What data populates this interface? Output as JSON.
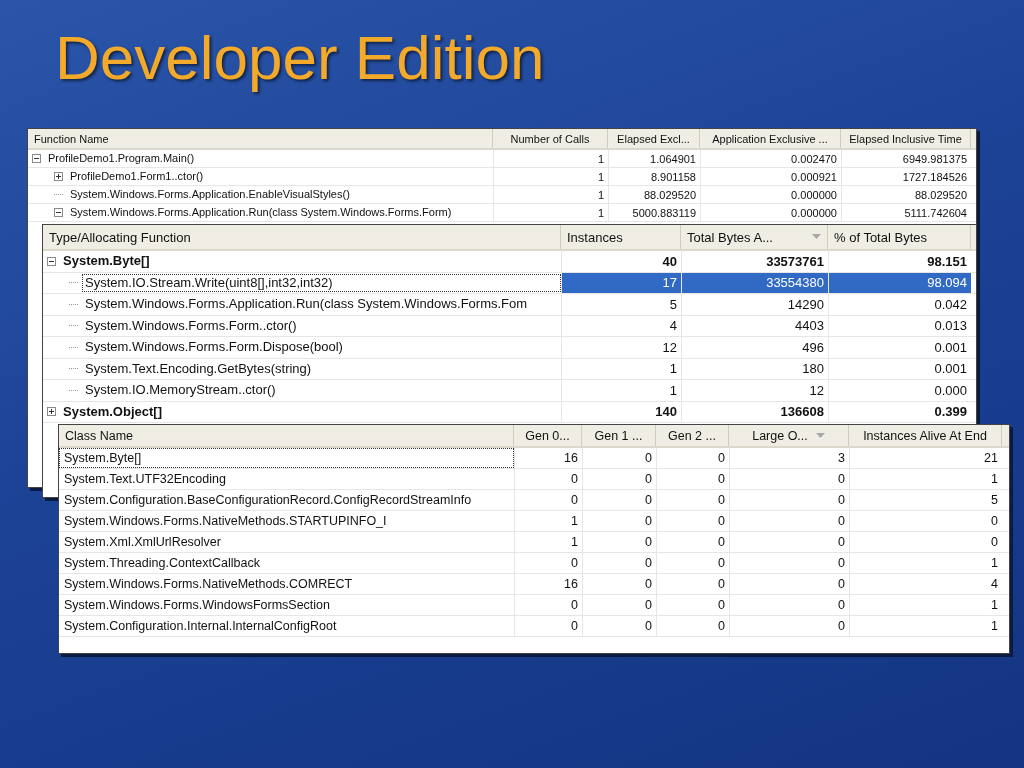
{
  "slide": {
    "title": "Developer Edition"
  },
  "panels": [
    {
      "name_column": {
        "label": "Function Name",
        "sorted": false
      },
      "columns": [
        {
          "label": "Number of Calls",
          "sorted": false
        },
        {
          "label": "Elapsed Excl...",
          "sorted": false
        },
        {
          "label": "Application Exclusive ...",
          "sorted": false
        },
        {
          "label": "Elapsed Inclusive Time",
          "sorted": false
        }
      ],
      "rows": [
        {
          "name": "ProfileDemo1.Program.Main()",
          "cells": [
            "1",
            "1.064901",
            "0.002470",
            "6949.981375"
          ],
          "expanded": true,
          "children": [
            {
              "name": "ProfileDemo1.Form1..ctor()",
              "cells": [
                "1",
                "8.901158",
                "0.000921",
                "1727.184526"
              ],
              "expanded": false
            },
            {
              "name": "System.Windows.Forms.Application.EnableVisualStyles()",
              "cells": [
                "1",
                "88.029520",
                "0.000000",
                "88.029520"
              ]
            },
            {
              "name": "System.Windows.Forms.Application.Run(class System.Windows.Forms.Form)",
              "cells": [
                "1",
                "5000.883119",
                "0.000000",
                "5111.742604"
              ],
              "expanded": true
            }
          ]
        }
      ]
    },
    {
      "name_column": {
        "label": "Type/Allocating Function",
        "sorted": false
      },
      "columns": [
        {
          "label": "Instances",
          "sorted": false
        },
        {
          "label": "Total Bytes A...",
          "sorted": true
        },
        {
          "label": "% of Total Bytes",
          "sorted": false
        }
      ],
      "rows": [
        {
          "name": "System.Byte[]",
          "bold": true,
          "cells": [
            "40",
            "33573761",
            "98.151"
          ],
          "expanded": true,
          "selected": false,
          "children": [
            {
              "name": "System.IO.Stream.Write(uint8[],int32,int32)",
              "cells": [
                "17",
                "33554380",
                "98.094"
              ],
              "selected": true
            },
            {
              "name": "System.Windows.Forms.Application.Run(class System.Windows.Forms.Fom",
              "cells": [
                "5",
                "14290",
                "0.042"
              ],
              "selected": false
            },
            {
              "name": "System.Windows.Forms.Form..ctor()",
              "cells": [
                "4",
                "4403",
                "0.013"
              ],
              "selected": false
            },
            {
              "name": "System.Windows.Forms.Form.Dispose(bool)",
              "cells": [
                "12",
                "496",
                "0.001"
              ],
              "selected": false
            },
            {
              "name": "System.Text.Encoding.GetBytes(string)",
              "cells": [
                "1",
                "180",
                "0.001"
              ],
              "selected": false
            },
            {
              "name": "System.IO.MemoryStream..ctor()",
              "cells": [
                "1",
                "12",
                "0.000"
              ],
              "selected": false
            }
          ]
        },
        {
          "name": "System.Object[]",
          "bold": true,
          "cells": [
            "140",
            "136608",
            "0.399"
          ],
          "expanded": false,
          "selected": false
        }
      ]
    },
    {
      "name_column": {
        "label": "Class Name",
        "sorted": false
      },
      "columns": [
        {
          "label": "Gen 0...",
          "sorted": false
        },
        {
          "label": "Gen 1 ...",
          "sorted": false
        },
        {
          "label": "Gen 2 ...",
          "sorted": false
        },
        {
          "label": "Large O...",
          "sorted": true
        },
        {
          "label": "Instances Alive At End",
          "sorted": false
        }
      ],
      "rows": [
        {
          "name": "System.Byte[]",
          "cells": [
            "16",
            "0",
            "0",
            "3",
            "21"
          ],
          "focused": true
        },
        {
          "name": "System.Text.UTF32Encoding",
          "cells": [
            "0",
            "0",
            "0",
            "0",
            "1"
          ],
          "focused": false
        },
        {
          "name": "System.Configuration.BaseConfigurationRecord.ConfigRecordStreamInfo",
          "cells": [
            "0",
            "0",
            "0",
            "0",
            "5"
          ],
          "focused": false
        },
        {
          "name": "System.Windows.Forms.NativeMethods.STARTUPINFO_I",
          "cells": [
            "1",
            "0",
            "0",
            "0",
            "0"
          ],
          "focused": false
        },
        {
          "name": "System.Xml.XmlUrlResolver",
          "cells": [
            "1",
            "0",
            "0",
            "0",
            "0"
          ],
          "focused": false
        },
        {
          "name": "System.Threading.ContextCallback",
          "cells": [
            "0",
            "0",
            "0",
            "0",
            "1"
          ],
          "focused": false
        },
        {
          "name": "System.Windows.Forms.NativeMethods.COMRECT",
          "cells": [
            "16",
            "0",
            "0",
            "0",
            "4"
          ],
          "focused": false
        },
        {
          "name": "System.Windows.Forms.WindowsFormsSection",
          "cells": [
            "0",
            "0",
            "0",
            "0",
            "1"
          ],
          "focused": false
        },
        {
          "name": "System.Configuration.Internal.InternalConfigRoot",
          "cells": [
            "0",
            "0",
            "0",
            "0",
            "1"
          ],
          "focused": false
        }
      ]
    }
  ]
}
